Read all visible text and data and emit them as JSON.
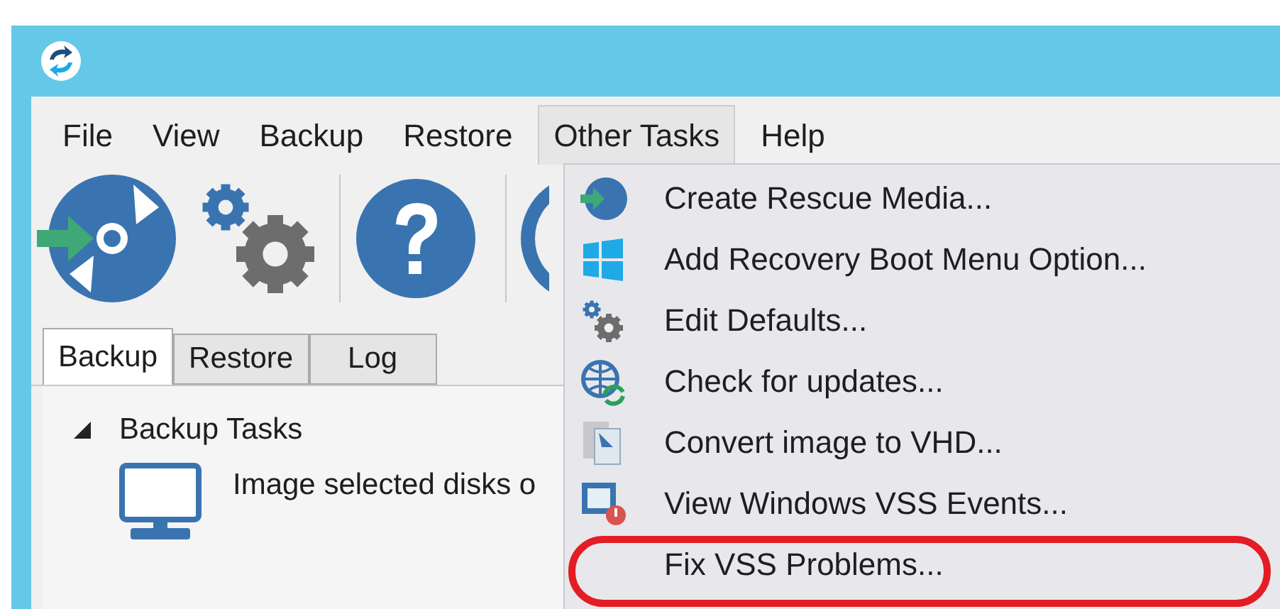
{
  "menu_bar": [
    {
      "label": "File",
      "selected": false
    },
    {
      "label": "View",
      "selected": false
    },
    {
      "label": "Backup",
      "selected": false
    },
    {
      "label": "Restore",
      "selected": false
    },
    {
      "label": "Other Tasks",
      "selected": true
    },
    {
      "label": "Help",
      "selected": false
    }
  ],
  "tabs": [
    {
      "label": "Backup",
      "selected": true
    },
    {
      "label": "Restore",
      "selected": false
    },
    {
      "label": "Log",
      "selected": false
    }
  ],
  "tree": [
    {
      "label": "Backup Tasks",
      "expanded": true,
      "children": [
        {
          "label": "Image selected disks o"
        }
      ]
    }
  ],
  "dropdown": {
    "items": [
      {
        "label": "Create Rescue Media..."
      },
      {
        "label": "Add Recovery Boot Menu Option..."
      },
      {
        "label": "Edit Defaults..."
      },
      {
        "label": "Check for updates..."
      },
      {
        "label": "Convert image to VHD..."
      },
      {
        "label": "View Windows VSS Events..."
      },
      {
        "label": "Fix VSS Problems..."
      }
    ]
  }
}
